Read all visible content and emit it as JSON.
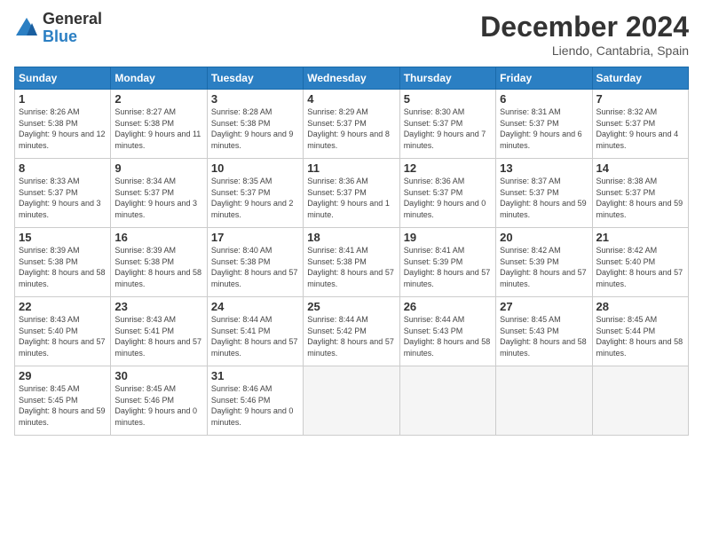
{
  "header": {
    "logo_general": "General",
    "logo_blue": "Blue",
    "month_title": "December 2024",
    "location": "Liendo, Cantabria, Spain"
  },
  "days_of_week": [
    "Sunday",
    "Monday",
    "Tuesday",
    "Wednesday",
    "Thursday",
    "Friday",
    "Saturday"
  ],
  "weeks": [
    [
      {
        "num": "1",
        "sunrise": "8:26 AM",
        "sunset": "5:38 PM",
        "daylight": "9 hours and 12 minutes."
      },
      {
        "num": "2",
        "sunrise": "8:27 AM",
        "sunset": "5:38 PM",
        "daylight": "9 hours and 11 minutes."
      },
      {
        "num": "3",
        "sunrise": "8:28 AM",
        "sunset": "5:38 PM",
        "daylight": "9 hours and 9 minutes."
      },
      {
        "num": "4",
        "sunrise": "8:29 AM",
        "sunset": "5:37 PM",
        "daylight": "9 hours and 8 minutes."
      },
      {
        "num": "5",
        "sunrise": "8:30 AM",
        "sunset": "5:37 PM",
        "daylight": "9 hours and 7 minutes."
      },
      {
        "num": "6",
        "sunrise": "8:31 AM",
        "sunset": "5:37 PM",
        "daylight": "9 hours and 6 minutes."
      },
      {
        "num": "7",
        "sunrise": "8:32 AM",
        "sunset": "5:37 PM",
        "daylight": "9 hours and 4 minutes."
      }
    ],
    [
      {
        "num": "8",
        "sunrise": "8:33 AM",
        "sunset": "5:37 PM",
        "daylight": "9 hours and 3 minutes."
      },
      {
        "num": "9",
        "sunrise": "8:34 AM",
        "sunset": "5:37 PM",
        "daylight": "9 hours and 3 minutes."
      },
      {
        "num": "10",
        "sunrise": "8:35 AM",
        "sunset": "5:37 PM",
        "daylight": "9 hours and 2 minutes."
      },
      {
        "num": "11",
        "sunrise": "8:36 AM",
        "sunset": "5:37 PM",
        "daylight": "9 hours and 1 minute."
      },
      {
        "num": "12",
        "sunrise": "8:36 AM",
        "sunset": "5:37 PM",
        "daylight": "9 hours and 0 minutes."
      },
      {
        "num": "13",
        "sunrise": "8:37 AM",
        "sunset": "5:37 PM",
        "daylight": "8 hours and 59 minutes."
      },
      {
        "num": "14",
        "sunrise": "8:38 AM",
        "sunset": "5:37 PM",
        "daylight": "8 hours and 59 minutes."
      }
    ],
    [
      {
        "num": "15",
        "sunrise": "8:39 AM",
        "sunset": "5:38 PM",
        "daylight": "8 hours and 58 minutes."
      },
      {
        "num": "16",
        "sunrise": "8:39 AM",
        "sunset": "5:38 PM",
        "daylight": "8 hours and 58 minutes."
      },
      {
        "num": "17",
        "sunrise": "8:40 AM",
        "sunset": "5:38 PM",
        "daylight": "8 hours and 57 minutes."
      },
      {
        "num": "18",
        "sunrise": "8:41 AM",
        "sunset": "5:38 PM",
        "daylight": "8 hours and 57 minutes."
      },
      {
        "num": "19",
        "sunrise": "8:41 AM",
        "sunset": "5:39 PM",
        "daylight": "8 hours and 57 minutes."
      },
      {
        "num": "20",
        "sunrise": "8:42 AM",
        "sunset": "5:39 PM",
        "daylight": "8 hours and 57 minutes."
      },
      {
        "num": "21",
        "sunrise": "8:42 AM",
        "sunset": "5:40 PM",
        "daylight": "8 hours and 57 minutes."
      }
    ],
    [
      {
        "num": "22",
        "sunrise": "8:43 AM",
        "sunset": "5:40 PM",
        "daylight": "8 hours and 57 minutes."
      },
      {
        "num": "23",
        "sunrise": "8:43 AM",
        "sunset": "5:41 PM",
        "daylight": "8 hours and 57 minutes."
      },
      {
        "num": "24",
        "sunrise": "8:44 AM",
        "sunset": "5:41 PM",
        "daylight": "8 hours and 57 minutes."
      },
      {
        "num": "25",
        "sunrise": "8:44 AM",
        "sunset": "5:42 PM",
        "daylight": "8 hours and 57 minutes."
      },
      {
        "num": "26",
        "sunrise": "8:44 AM",
        "sunset": "5:43 PM",
        "daylight": "8 hours and 58 minutes."
      },
      {
        "num": "27",
        "sunrise": "8:45 AM",
        "sunset": "5:43 PM",
        "daylight": "8 hours and 58 minutes."
      },
      {
        "num": "28",
        "sunrise": "8:45 AM",
        "sunset": "5:44 PM",
        "daylight": "8 hours and 58 minutes."
      }
    ],
    [
      {
        "num": "29",
        "sunrise": "8:45 AM",
        "sunset": "5:45 PM",
        "daylight": "8 hours and 59 minutes."
      },
      {
        "num": "30",
        "sunrise": "8:45 AM",
        "sunset": "5:46 PM",
        "daylight": "9 hours and 0 minutes."
      },
      {
        "num": "31",
        "sunrise": "8:46 AM",
        "sunset": "5:46 PM",
        "daylight": "9 hours and 0 minutes."
      },
      null,
      null,
      null,
      null
    ]
  ]
}
